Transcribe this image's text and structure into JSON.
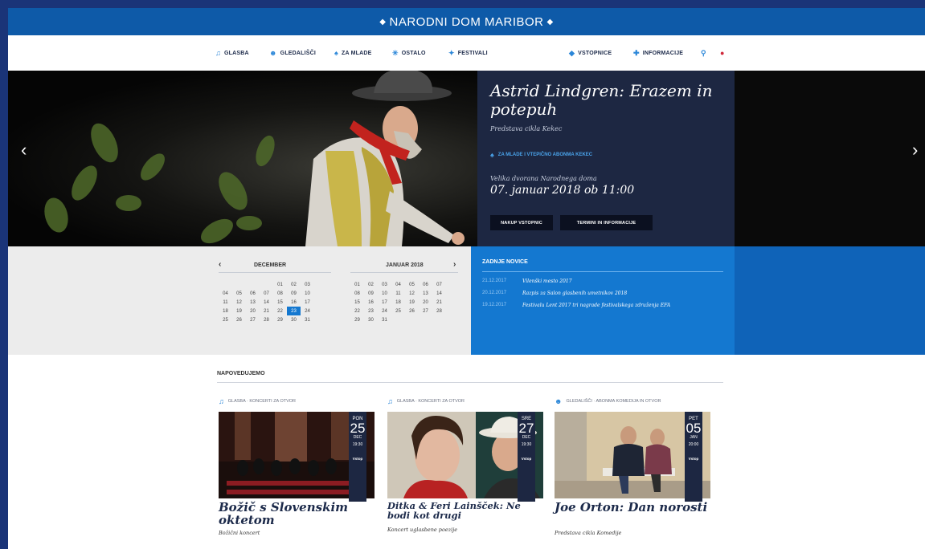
{
  "site_title": "NARODNI DOM MARIBOR",
  "nav": {
    "items": [
      {
        "label": "GLASBA",
        "icon": "music-note-icon"
      },
      {
        "label": "GLEDALIŠČI",
        "icon": "theatre-masks-icon"
      },
      {
        "label": "ZA MLADE",
        "icon": "balloon-icon"
      },
      {
        "label": "OSTALO",
        "icon": "sparkle-icon"
      },
      {
        "label": "FESTIVALI",
        "icon": "festival-icon"
      }
    ],
    "tickets": "VSTOPNICE",
    "info": "INFORMACIJE",
    "search_icon": "search-icon",
    "lang_icon": "language-flag-icon"
  },
  "hero": {
    "title": "Astrid Lindgren: Erazem in potepuh",
    "subtitle": "Predstava cikla Kekec",
    "category": "ZA MLADE I VTEPIČNO ABONMA KEKEC",
    "venue": "Velika dvorana Narodnega doma",
    "date": "07. januar 2018 ob 11:00",
    "btn_buy": "NAKUP VSTOPNIC",
    "btn_info": "TERMINI IN INFORMACIJE",
    "prev": "‹",
    "next": "›"
  },
  "calendar": {
    "prev": "‹",
    "next": "›",
    "left": {
      "title": "DECEMBER",
      "days": [
        "",
        "",
        "",
        "",
        "01",
        "02",
        "03",
        "04",
        "05",
        "06",
        "07",
        "08",
        "09",
        "10",
        "11",
        "12",
        "13",
        "14",
        "15",
        "16",
        "17",
        "18",
        "19",
        "20",
        "21",
        "22",
        "23",
        "24",
        "25",
        "26",
        "27",
        "28",
        "29",
        "30",
        "31"
      ]
    },
    "right": {
      "title": "JANUAR 2018",
      "days": [
        "01",
        "02",
        "03",
        "04",
        "05",
        "06",
        "07",
        "08",
        "09",
        "10",
        "11",
        "12",
        "13",
        "14",
        "15",
        "16",
        "17",
        "18",
        "19",
        "20",
        "21",
        "22",
        "23",
        "24",
        "25",
        "26",
        "27",
        "28",
        "29",
        "30",
        "31"
      ]
    }
  },
  "news": {
    "title": "ZADNJE NOVICE",
    "items": [
      {
        "date": "21.12.2017",
        "title": "Vilenški mesto 2017"
      },
      {
        "date": "20.12.2017",
        "title": "Razpis za Salon glasbenih umetnikov 2018"
      },
      {
        "date": "19.12.2017",
        "title": "Festivalu Lent 2017 tri nagrade festivalskega združenja EFA"
      }
    ]
  },
  "section_title": "NAPOVEDUJEMO",
  "cards": [
    {
      "category": "GLASBA · KONCERTI ZA OTVOR",
      "icon": "music-note-icon",
      "dow": "PON",
      "day": "25",
      "month": "DEC",
      "time": "19:30",
      "btn": "Vstop",
      "title": "Božič s Slovenskim oktetom",
      "subtitle": "Božični koncert"
    },
    {
      "category": "GLASBA · KONCERTI ZA OTVOR",
      "icon": "music-note-icon",
      "dow": "SRE",
      "day": "27",
      "month": "DEC",
      "time": "19:30",
      "btn": "Vstop",
      "title": "Ditka & Feri Lainšček: Ne bodi kot drugi",
      "subtitle": "Koncert uglasbene poezije"
    },
    {
      "category": "GLEDALIŠČI · ABONMA KOMEDIJA IN OTVOR",
      "icon": "theatre-masks-icon",
      "dow": "PET",
      "day": "05",
      "month": "JAN",
      "time": "20:00",
      "btn": "Vstop",
      "title": "Joe Orton: Dan norosti",
      "subtitle": "Predstava cikla Komedije"
    }
  ]
}
